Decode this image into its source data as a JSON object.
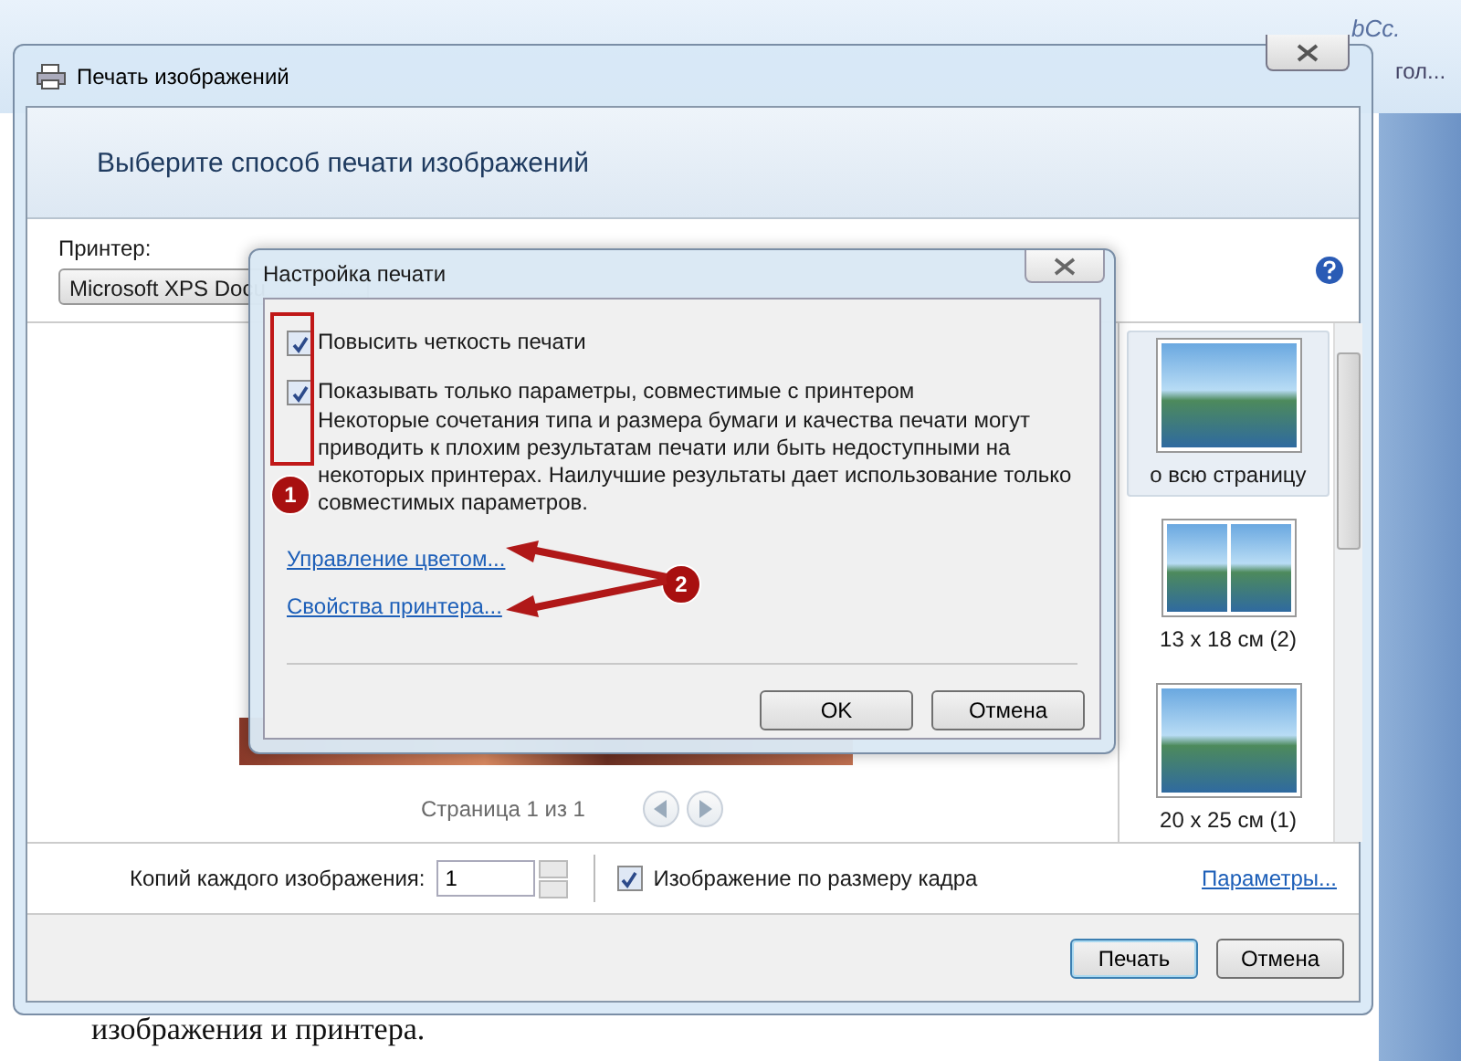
{
  "background_ribbon": {
    "style_labels": [
      "гол...",
      "bCc."
    ]
  },
  "window": {
    "title": "Печать изображений",
    "heading": "Выберите способ печати изображений"
  },
  "printer": {
    "label": "Принтер:",
    "value": "Microsoft XPS Docu"
  },
  "preview": {
    "page_indicator": "Страница 1 из 1"
  },
  "layouts": [
    {
      "label": "о всю страницу",
      "selected": true,
      "kind": "single"
    },
    {
      "label": "13 x 18 см (2)",
      "selected": false,
      "kind": "double"
    },
    {
      "label": "20 x 25 см (1)",
      "selected": false,
      "kind": "single"
    }
  ],
  "copies": {
    "label": "Копий каждого изображения:",
    "value": "1"
  },
  "fit_frame": {
    "label": "Изображение по размеру кадра",
    "checked": true
  },
  "options_link": "Параметры...",
  "buttons": [
    "Печать",
    "Отмена"
  ],
  "dialog": {
    "title": "Настройка печати",
    "options": [
      {
        "label": "Повысить четкость печати",
        "checked": true
      },
      {
        "label": "Показывать только параметры, совместимые с принтером",
        "checked": true,
        "note": "Некоторые сочетания типа и размера бумаги и качества печати могут приводить к плохим результатам печати или быть недоступными на некоторых принтерах. Наилучшие результаты дает использование только совместимых параметров."
      }
    ],
    "links": [
      "Управление цветом...",
      "Свойства принтера..."
    ],
    "buttons": [
      "OK",
      "Отмена"
    ]
  },
  "annotations": [
    "1",
    "2"
  ],
  "document_text": "изображения и принтера."
}
